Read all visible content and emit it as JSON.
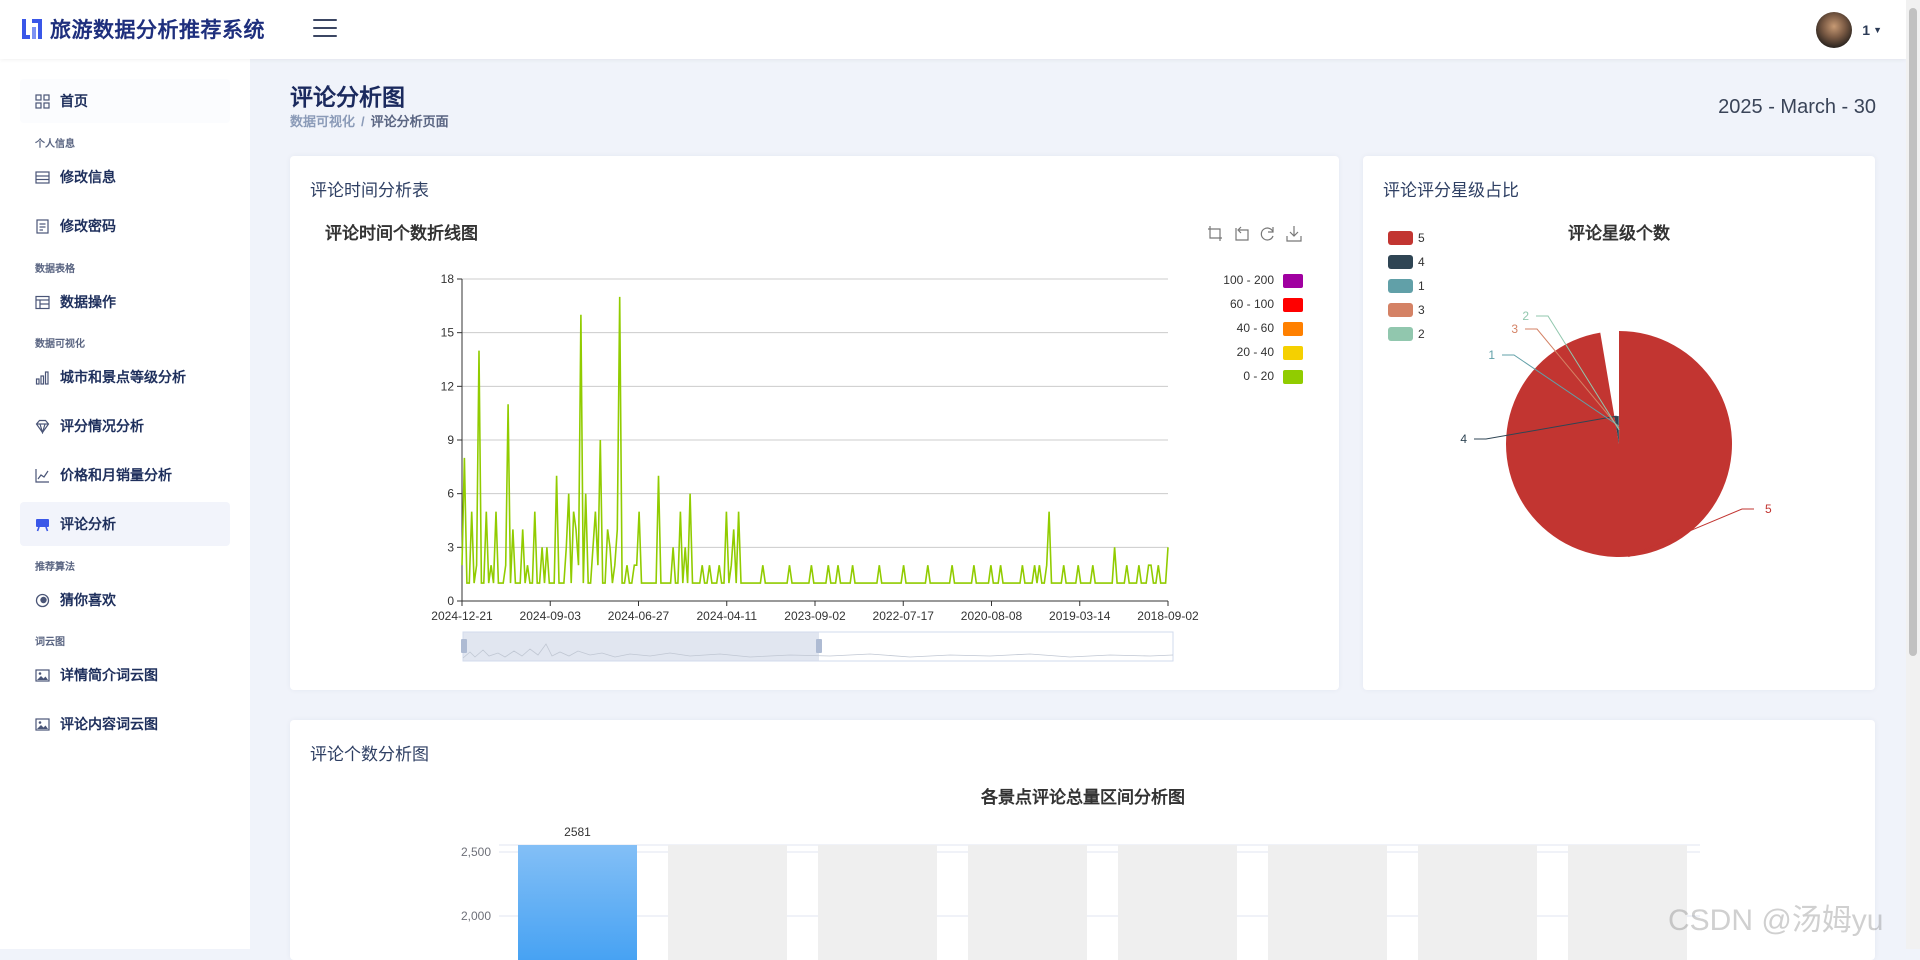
{
  "header": {
    "app_title": "旅游数据分析推荐系统",
    "user_name": "1"
  },
  "sidebar": {
    "home": "首页",
    "sections": {
      "personal": "个人信息",
      "table": "数据表格",
      "viz": "数据可视化",
      "recommend": "推荐算法",
      "wordcloud": "词云图"
    },
    "items": {
      "edit_info": "修改信息",
      "change_pwd": "修改密码",
      "data_ops": "数据操作",
      "city_level": "城市和景点等级分析",
      "score": "评分情况分析",
      "price_sales": "价格和月销量分析",
      "comment": "评论分析",
      "guess": "猜你喜欢",
      "detail_cloud": "详情简介词云图",
      "comment_cloud": "评论内容词云图"
    }
  },
  "page": {
    "title": "评论分析图",
    "breadcrumb_parent": "数据可视化",
    "breadcrumb_sep": "/",
    "breadcrumb_current": "评论分析页面",
    "date": "2025 - March - 30"
  },
  "cards": {
    "time_card_title": "评论时间分析表",
    "star_card_title": "评论评分星级占比",
    "count_card_title": "评论个数分析图"
  },
  "watermark": "CSDN @汤姆yu",
  "colors": {
    "accent": "#4b5ee8",
    "line": "#91cc00",
    "pie_5": "#c23531",
    "pie_4": "#2f4554",
    "pie_1": "#61a0a8",
    "pie_3": "#d48265",
    "pie_2": "#91c7ae",
    "bar": "#4ea5f5"
  },
  "chart_data": [
    {
      "type": "line",
      "title": "评论时间个数折线图",
      "x_ticks": [
        "2024-12-21",
        "2024-09-03",
        "2024-06-27",
        "2024-04-11",
        "2023-09-02",
        "2022-07-17",
        "2020-08-08",
        "2019-03-14",
        "2018-09-02"
      ],
      "y_ticks": [
        0,
        3,
        6,
        9,
        12,
        15,
        18
      ],
      "ylim": [
        0,
        18
      ],
      "visual_map": [
        "100 - 200",
        "60 - 100",
        "40 - 60",
        "20 - 40",
        "0 - 20"
      ],
      "visual_map_colors": [
        "#a000a0",
        "#ff0000",
        "#ff8000",
        "#f5d000",
        "#91cc00"
      ],
      "grid": true,
      "series": [
        {
          "values": [
            2,
            8,
            1,
            1,
            5,
            1,
            2,
            14,
            1,
            1,
            5,
            1,
            2,
            1,
            5,
            1,
            1,
            1,
            2,
            11,
            1,
            4,
            1,
            1,
            1,
            4,
            1,
            2,
            1,
            1,
            5,
            1,
            1,
            3,
            1,
            3,
            1,
            1,
            1,
            7,
            1,
            1,
            1,
            3,
            6,
            1,
            5,
            4,
            2,
            16,
            1,
            6,
            1,
            1,
            3,
            5,
            2,
            9,
            1,
            1,
            4,
            3,
            1,
            2,
            4,
            17,
            1,
            1,
            2,
            1,
            1,
            2,
            2,
            5,
            1,
            1,
            1,
            1,
            1,
            1,
            1,
            7,
            1,
            1,
            1,
            1,
            1,
            3,
            1,
            1,
            5,
            1,
            3,
            1,
            6,
            1,
            1,
            1,
            1,
            2,
            1,
            1,
            2,
            1,
            1,
            1,
            2,
            1,
            1,
            5,
            1,
            2,
            4,
            1,
            5,
            1,
            1,
            1,
            1,
            1,
            1,
            1,
            1,
            1,
            2,
            1,
            1,
            1,
            1,
            1,
            1,
            1,
            1,
            1,
            1,
            2,
            1,
            1,
            1,
            1,
            1,
            1,
            1,
            1,
            2,
            1,
            1,
            1,
            1,
            1,
            1,
            2,
            1,
            1,
            1,
            2,
            1,
            1,
            1,
            1,
            1,
            2,
            1,
            1,
            1,
            1,
            1,
            1,
            1,
            1,
            1,
            1,
            2,
            1,
            1,
            1,
            1,
            1,
            1,
            1,
            1,
            1,
            2,
            1,
            1,
            1,
            1,
            1,
            1,
            1,
            1,
            1,
            2,
            1,
            1,
            1,
            1,
            1,
            1,
            1,
            1,
            1,
            2,
            1,
            1,
            1,
            1,
            1,
            1,
            1,
            1,
            2,
            1,
            1,
            1,
            1,
            1,
            1,
            2,
            1,
            1,
            1,
            2,
            1,
            1,
            1,
            1,
            1,
            1,
            1,
            1,
            2,
            1,
            1,
            1,
            1,
            2,
            1,
            2,
            1,
            1,
            2,
            5,
            1,
            1,
            1,
            1,
            1,
            2,
            1,
            1,
            1,
            1,
            1,
            2,
            1,
            1,
            1,
            1,
            1,
            2,
            1,
            1,
            1,
            1,
            1,
            1,
            1,
            1,
            3,
            1,
            1,
            1,
            1,
            2,
            1,
            1,
            1,
            1,
            2,
            1,
            1,
            1,
            2,
            2,
            1,
            1,
            2,
            1,
            1,
            1,
            3
          ]
        }
      ]
    },
    {
      "type": "pie",
      "title": "评论星级个数",
      "legend": [
        "5",
        "4",
        "1",
        "3",
        "2"
      ],
      "slices": [
        {
          "name": "5",
          "value": 1872
        },
        {
          "name": "4",
          "value": 48
        },
        {
          "name": "1",
          "value": 1
        },
        {
          "name": "3",
          "value": 1
        },
        {
          "name": "2",
          "value": 1
        }
      ]
    },
    {
      "type": "bar",
      "title": "各景点评论总量区间分析图",
      "y_ticks": [
        "2,500",
        "2,000"
      ],
      "series": [
        {
          "values": [
            2581
          ]
        }
      ],
      "data_labels": [
        "2581"
      ]
    }
  ]
}
